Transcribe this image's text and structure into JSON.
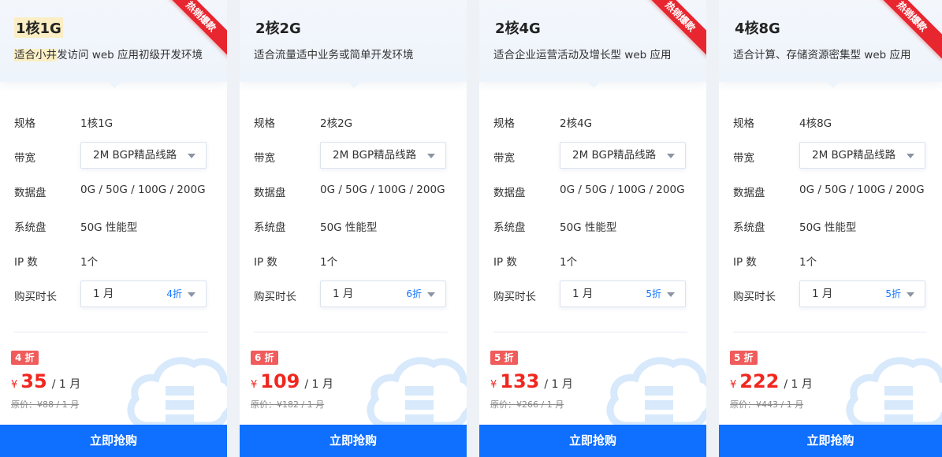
{
  "labels": {
    "spec": "规格",
    "bandwidth": "带宽",
    "datadisk": "数据盘",
    "sysdisk": "系统盘",
    "ip": "IP 数",
    "duration": "购买时长",
    "price_currency": "¥",
    "buy": "立即抢购",
    "hot": "热销爆款"
  },
  "colors": {
    "accent": "#0f6fff",
    "hot": "#e8262f",
    "price": "#f0271f"
  },
  "cards": [
    {
      "title": "1核1G",
      "subtitle_pre": "适合小井",
      "subtitle_post": "发访问 web 应用初级开发环境",
      "hot": true,
      "spec": "1核1G",
      "bandwidth": "2M BGP精品线路",
      "datadisk": "0G / 50G / 100G / 200G",
      "sysdisk": "50G 性能型",
      "ip": "1个",
      "duration": "1 月",
      "duration_discount": "4折",
      "badge": "4 折",
      "price": "35",
      "per": "/ 1 月",
      "original": "原价：¥88 / 1 月"
    },
    {
      "title": "2核2G",
      "subtitle_pre": "",
      "subtitle_post": "适合流量适中业务或简单开发环境",
      "hot": false,
      "spec": "2核2G",
      "bandwidth": "2M BGP精品线路",
      "datadisk": "0G / 50G / 100G / 200G",
      "sysdisk": "50G 性能型",
      "ip": "1个",
      "duration": "1 月",
      "duration_discount": "6折",
      "badge": "6 折",
      "price": "109",
      "per": "/ 1 月",
      "original": "原价：¥182 / 1 月"
    },
    {
      "title": "2核4G",
      "subtitle_pre": "",
      "subtitle_post": "适合企业运营活动及增长型 web 应用",
      "hot": true,
      "spec": "2核4G",
      "bandwidth": "2M BGP精品线路",
      "datadisk": "0G / 50G / 100G / 200G",
      "sysdisk": "50G 性能型",
      "ip": "1个",
      "duration": "1 月",
      "duration_discount": "5折",
      "badge": "5 折",
      "price": "133",
      "per": "/ 1 月",
      "original": "原价：¥266 / 1 月"
    },
    {
      "title": "4核8G",
      "subtitle_pre": "",
      "subtitle_post": "适合计算、存储资源密集型 web 应用",
      "hot": true,
      "spec": "4核8G",
      "bandwidth": "2M BGP精品线路",
      "datadisk": "0G / 50G / 100G / 200G",
      "sysdisk": "50G 性能型",
      "ip": "1个",
      "duration": "1 月",
      "duration_discount": "5折",
      "badge": "5 折",
      "price": "222",
      "per": "/ 1 月",
      "original": "原价：¥443 / 1 月"
    }
  ]
}
